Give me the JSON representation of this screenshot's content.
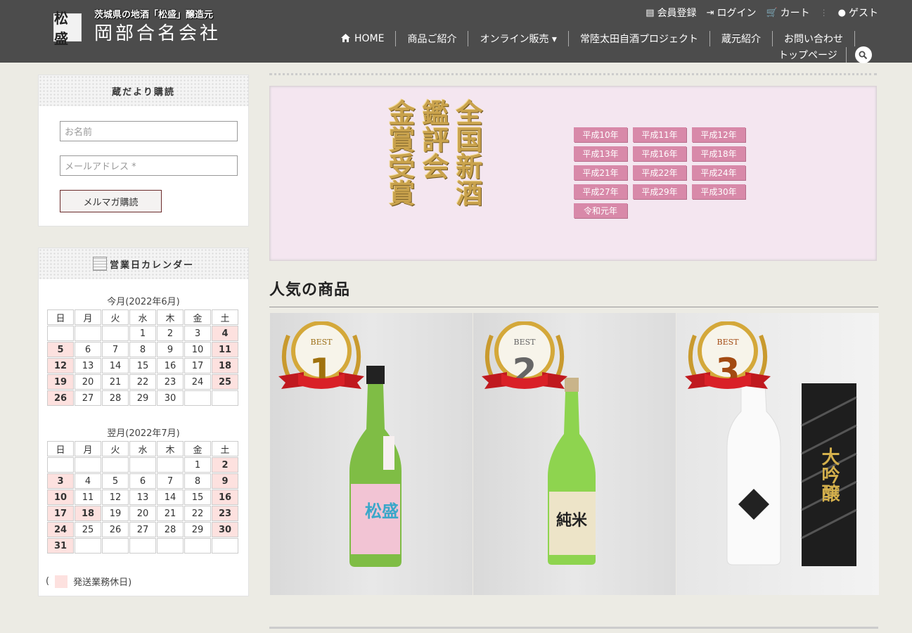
{
  "header": {
    "logo_mark": "松盛",
    "tagline": "茨城県の地酒「松盛」醸造元",
    "company": "岡部合名会社",
    "util": [
      {
        "icon": "member-icon",
        "glyph": "▤",
        "label": "会員登録"
      },
      {
        "icon": "login-icon",
        "glyph": "⇥",
        "label": "ログイン"
      },
      {
        "icon": "cart-icon",
        "glyph": "🛒",
        "label": "カート"
      },
      {
        "icon": "user-icon",
        "glyph": "●",
        "label": "ゲスト"
      }
    ],
    "nav": [
      {
        "label": "HOME",
        "icon": "home-icon"
      },
      {
        "label": "商品ご紹介"
      },
      {
        "label": "オンライン販売 ▾"
      },
      {
        "label": "常陸太田自酒プロジェクト"
      },
      {
        "label": "蔵元紹介"
      },
      {
        "label": "お問い合わせ"
      }
    ],
    "nav2": {
      "label": "トップページ"
    }
  },
  "mailmag": {
    "title": "蔵だより購読",
    "name_placeholder": "お名前",
    "email_placeholder": "メールアドレス *",
    "button": "メルマガ購読"
  },
  "calendar": {
    "title": "営業日カレンダー",
    "weekdays": [
      "日",
      "月",
      "火",
      "水",
      "木",
      "金",
      "土"
    ],
    "months": [
      {
        "title": "今月(2022年6月)",
        "weeks": [
          [
            "",
            "",
            "",
            "1",
            "2",
            "3",
            "4"
          ],
          [
            "5",
            "6",
            "7",
            "8",
            "9",
            "10",
            "11"
          ],
          [
            "12",
            "13",
            "14",
            "15",
            "16",
            "17",
            "18"
          ],
          [
            "19",
            "20",
            "21",
            "22",
            "23",
            "24",
            "25"
          ],
          [
            "26",
            "27",
            "28",
            "29",
            "30",
            "",
            ""
          ]
        ],
        "holidays": [
          "4",
          "5",
          "11",
          "12",
          "18",
          "19",
          "25",
          "26"
        ]
      },
      {
        "title": "翌月(2022年7月)",
        "weeks": [
          [
            "",
            "",
            "",
            "",
            "",
            "1",
            "2"
          ],
          [
            "3",
            "4",
            "5",
            "6",
            "7",
            "8",
            "9"
          ],
          [
            "10",
            "11",
            "12",
            "13",
            "14",
            "15",
            "16"
          ],
          [
            "17",
            "18",
            "19",
            "20",
            "21",
            "22",
            "23"
          ],
          [
            "24",
            "25",
            "26",
            "27",
            "28",
            "29",
            "30"
          ],
          [
            "31",
            "",
            "",
            "",
            "",
            "",
            ""
          ]
        ],
        "holidays": [
          "2",
          "3",
          "9",
          "10",
          "16",
          "17",
          "18",
          "23",
          "24",
          "30",
          "31"
        ]
      }
    ],
    "legend_open": "(",
    "legend_label": "発送業務休日)"
  },
  "banner": {
    "columns": [
      "全国新酒",
      "鑑評会",
      "金賞受賞"
    ],
    "years": [
      "平成10年",
      "平成11年",
      "平成12年",
      "平成13年",
      "平成16年",
      "平成18年",
      "平成21年",
      "平成22年",
      "平成24年",
      "平成27年",
      "平成29年",
      "平成30年",
      "令和元年"
    ]
  },
  "popular": {
    "title": "人気の商品",
    "items": [
      {
        "rank": "1",
        "best": "BEST",
        "rank_color": "#a0720e",
        "label": "松盛"
      },
      {
        "rank": "2",
        "best": "BEST",
        "rank_color": "#666666",
        "label": "純米"
      },
      {
        "rank": "3",
        "best": "BEST",
        "rank_color": "#a34a12",
        "label": "大吟醸"
      }
    ]
  },
  "colors": {
    "header_bg": "#4c4c4c",
    "page_bg": "#ecebe4",
    "holiday": "#fde1df",
    "year_badge": "#d889a9"
  }
}
